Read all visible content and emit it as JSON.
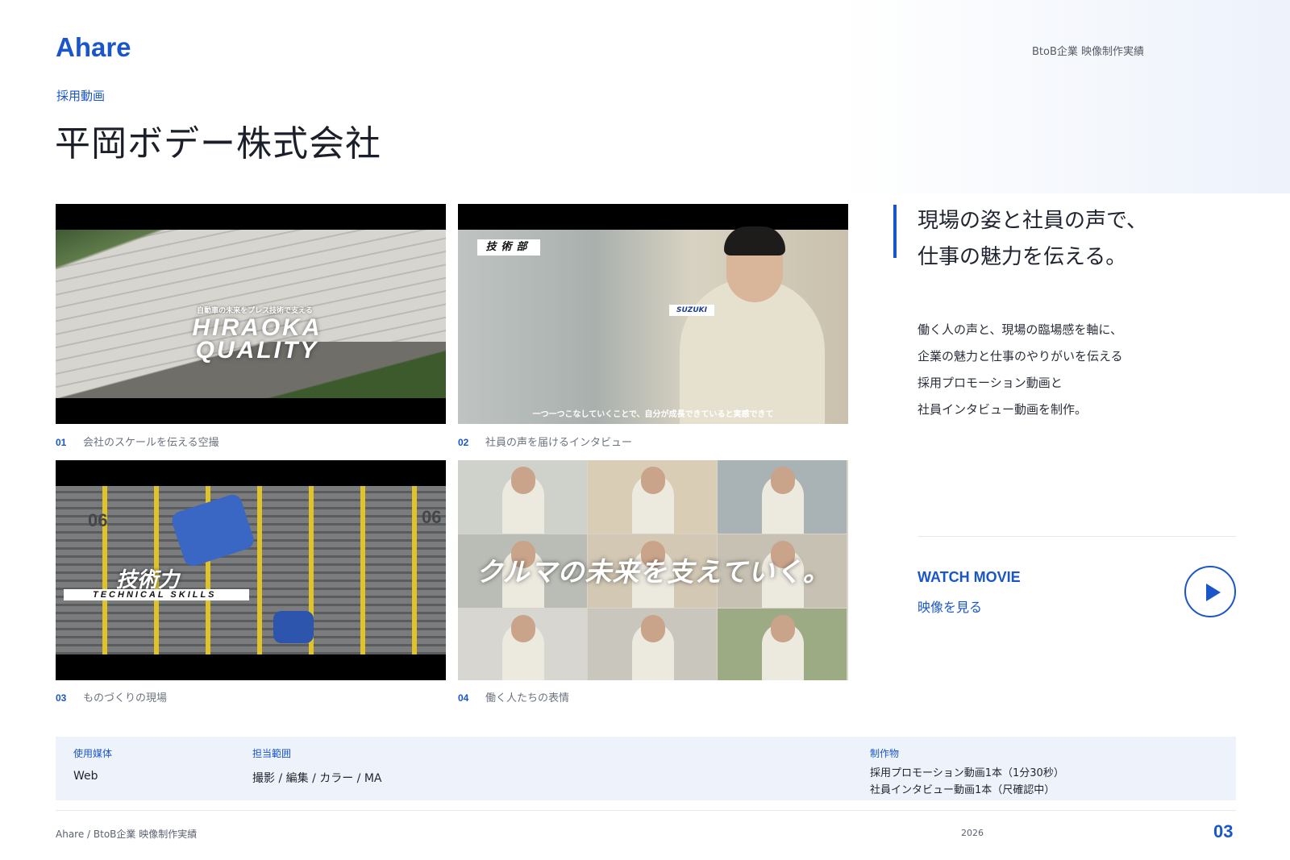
{
  "header": {
    "logo": "Ahare",
    "tag": "BtoB企業 映像制作実績"
  },
  "project": {
    "category": "採用動画",
    "title": "平岡ボデー株式会社"
  },
  "thumbnails": [
    {
      "num": "01",
      "caption": "会社のスケールを伝える空撮",
      "overlay_sub": "自動車の未来をプレス技術で支える",
      "overlay_main": "HIRAOKA QUALITY"
    },
    {
      "num": "02",
      "caption": "社員の声を届けるインタビュー",
      "label": "技術部",
      "brand": "SUZUKI",
      "subtitle": "一つ一つこなしていくことで、自分が成長できていると実感できて"
    },
    {
      "num": "03",
      "caption": "ものづくりの現場",
      "overlay_main": "技術力",
      "overlay_sub": "TECHNICAL SKILLS",
      "machine_nos": [
        "06",
        "06"
      ]
    },
    {
      "num": "04",
      "caption": "働く人たちの表情",
      "overlay_main": "クルマの未来を支えていく。"
    }
  ],
  "lead": {
    "line1": "現場の姿と社員の声で、",
    "line2": "仕事の魅力を伝える。"
  },
  "body": {
    "lines": [
      "働く人の声と、現場の臨場感を軸に、",
      "企業の魅力と仕事のやりがいを伝える",
      "採用プロモーション動画と",
      "社員インタビュー動画を制作。"
    ]
  },
  "watch": {
    "en": "WATCH MOVIE",
    "ja": "映像を見る",
    "icon": "play-icon"
  },
  "info": {
    "media_label": "使用媒体",
    "media_value": "Web",
    "scope_label": "担当範囲",
    "scope_value": "撮影 / 編集 / カラー / MA",
    "deliverables_label": "制作物",
    "deliverables": [
      "採用プロモーション動画1本（1分30秒）",
      "社員インタビュー動画1本（尺確認中）"
    ]
  },
  "footer": {
    "breadcrumb": "Ahare  /  BtoB企業 映像制作実績",
    "year": "2026",
    "page": "03"
  },
  "colors": {
    "accent": "#1a56c9",
    "info_bg": "#eef3fb"
  }
}
